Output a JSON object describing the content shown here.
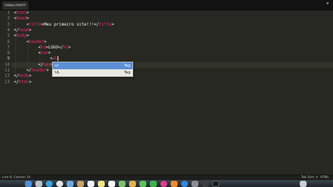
{
  "tab": {
    "filename": "index.html",
    "close_glyph": "×",
    "menu_arrow": "▾"
  },
  "gutter": [
    "1",
    "2",
    "3",
    "4",
    "5",
    "6",
    "7",
    "8",
    "9",
    "10",
    "11",
    "12",
    "13"
  ],
  "code": {
    "l1_tag": "html",
    "l2_tag": "head",
    "l3_tag": "title",
    "l3_text": "Meu primeiro site!!!",
    "l4_tag": "head",
    "l5_tag": "body",
    "l6_tag": "header",
    "l7_tag": "h1",
    "l7_text": "LOGO",
    "l8_tag": "nav",
    "l9_text": "ul",
    "l10_tag": "nav",
    "l11_tag": "header",
    "l12_tag": "body",
    "l13_tag": "html"
  },
  "autocomplete": {
    "items": [
      {
        "label": "ul",
        "kind": "Tag"
      },
      {
        "label": "UL",
        "kind": "Tag"
      }
    ]
  },
  "status": {
    "position": "Line 9, Column 14",
    "tab_size": "Tab Size: 4",
    "syntax": "HTML"
  },
  "colors": {
    "editor_bg": "#272822",
    "tag": "#f92672",
    "text": "#f8f8f2",
    "line_number": "#8f908a",
    "selection": "#5b8fd6"
  },
  "dock": {
    "icons": [
      "finder-icon",
      "launchpad-icon",
      "safari-icon",
      "chrome-icon",
      "mail-icon",
      "contacts-icon",
      "calendar-icon",
      "notes-icon",
      "reminders-icon",
      "maps-icon",
      "photos-icon",
      "messages-icon",
      "facetime-icon",
      "itunes-icon",
      "ibooks-icon",
      "appstore-icon",
      "preferences-icon",
      "sublime-icon",
      "terminal-icon",
      "trash-icon"
    ]
  }
}
